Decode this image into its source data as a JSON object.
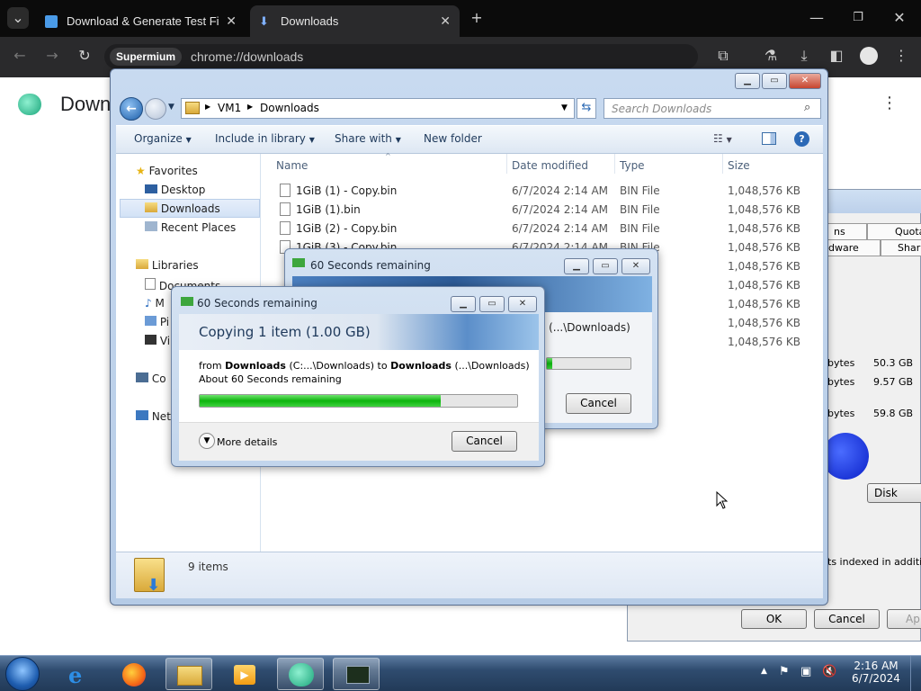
{
  "browser": {
    "tabs": [
      {
        "title": "Download & Generate Test File"
      },
      {
        "title": "Downloads"
      }
    ],
    "new_tab_icon": "plus-icon",
    "site_chip": "Supermium",
    "url": "chrome://downloads"
  },
  "downloads_page": {
    "title": "Downloads"
  },
  "explorer": {
    "breadcrumb": [
      "VM1",
      "Downloads"
    ],
    "search_placeholder": "Search Downloads",
    "menu": {
      "organize": "Organize",
      "include": "Include in library",
      "share": "Share with",
      "new_folder": "New folder"
    },
    "nav": {
      "favorites": "Favorites",
      "desktop": "Desktop",
      "downloads": "Downloads",
      "recent": "Recent Places",
      "libraries": "Libraries",
      "documents": "Documents",
      "music": "M",
      "pictures": "Pi",
      "videos": "Vi",
      "computer": "Co",
      "network": "Net"
    },
    "columns": {
      "name": "Name",
      "date": "Date modified",
      "type": "Type",
      "size": "Size"
    },
    "files": [
      {
        "name": "1GiB (1) - Copy.bin",
        "date": "6/7/2024 2:14 AM",
        "type": "BIN File",
        "size": "1,048,576 KB"
      },
      {
        "name": "1GiB (1).bin",
        "date": "6/7/2024 2:14 AM",
        "type": "BIN File",
        "size": "1,048,576 KB"
      },
      {
        "name": "1GiB (2) - Copy.bin",
        "date": "6/7/2024 2:14 AM",
        "type": "BIN File",
        "size": "1,048,576 KB"
      },
      {
        "name": "1GiB (3) - Copy.bin",
        "date": "6/7/2024 2:14 AM",
        "type": "BIN File",
        "size": "1,048,576 KB"
      }
    ],
    "extra_sizes": [
      "1,048,576 KB",
      "1,048,576 KB",
      "1,048,576 KB",
      "1,048,576 KB",
      "1,048,576 KB"
    ],
    "status": "9 items"
  },
  "copy_dialog_back": {
    "title": "60 Seconds remaining",
    "fragment": "s (...\\Downloads)",
    "cancel": "Cancel",
    "progress": 0.06
  },
  "copy_dialog_front": {
    "title": "60 Seconds remaining",
    "heading": "Copying 1 item (1.00 GB)",
    "from_label": "from",
    "from_name": "Downloads",
    "from_path": "(C:...\\Downloads)",
    "to_label": "to",
    "to_name": "Downloads",
    "to_path": "(...\\Downloads)",
    "remaining": "About 60 Seconds remaining",
    "progress": 0.76,
    "more_details": "More details",
    "cancel": "Cancel"
  },
  "properties_window": {
    "tabs_row1": [
      "ns",
      "Quota"
    ],
    "tabs_row2": [
      "dware",
      "Sharin"
    ],
    "rows": [
      {
        "unit": "bytes",
        "value": "50.3 GB"
      },
      {
        "unit": "bytes",
        "value": "9.57 GB"
      },
      {
        "unit": "bytes",
        "value": "59.8 GB"
      }
    ],
    "disk_cleanup": "Disk Clean",
    "index_text": "ts indexed in addition",
    "ok": "OK",
    "cancel": "Cancel",
    "apply": "Ap"
  },
  "taskbar": {
    "time": "2:16 AM",
    "date": "6/7/2024"
  }
}
